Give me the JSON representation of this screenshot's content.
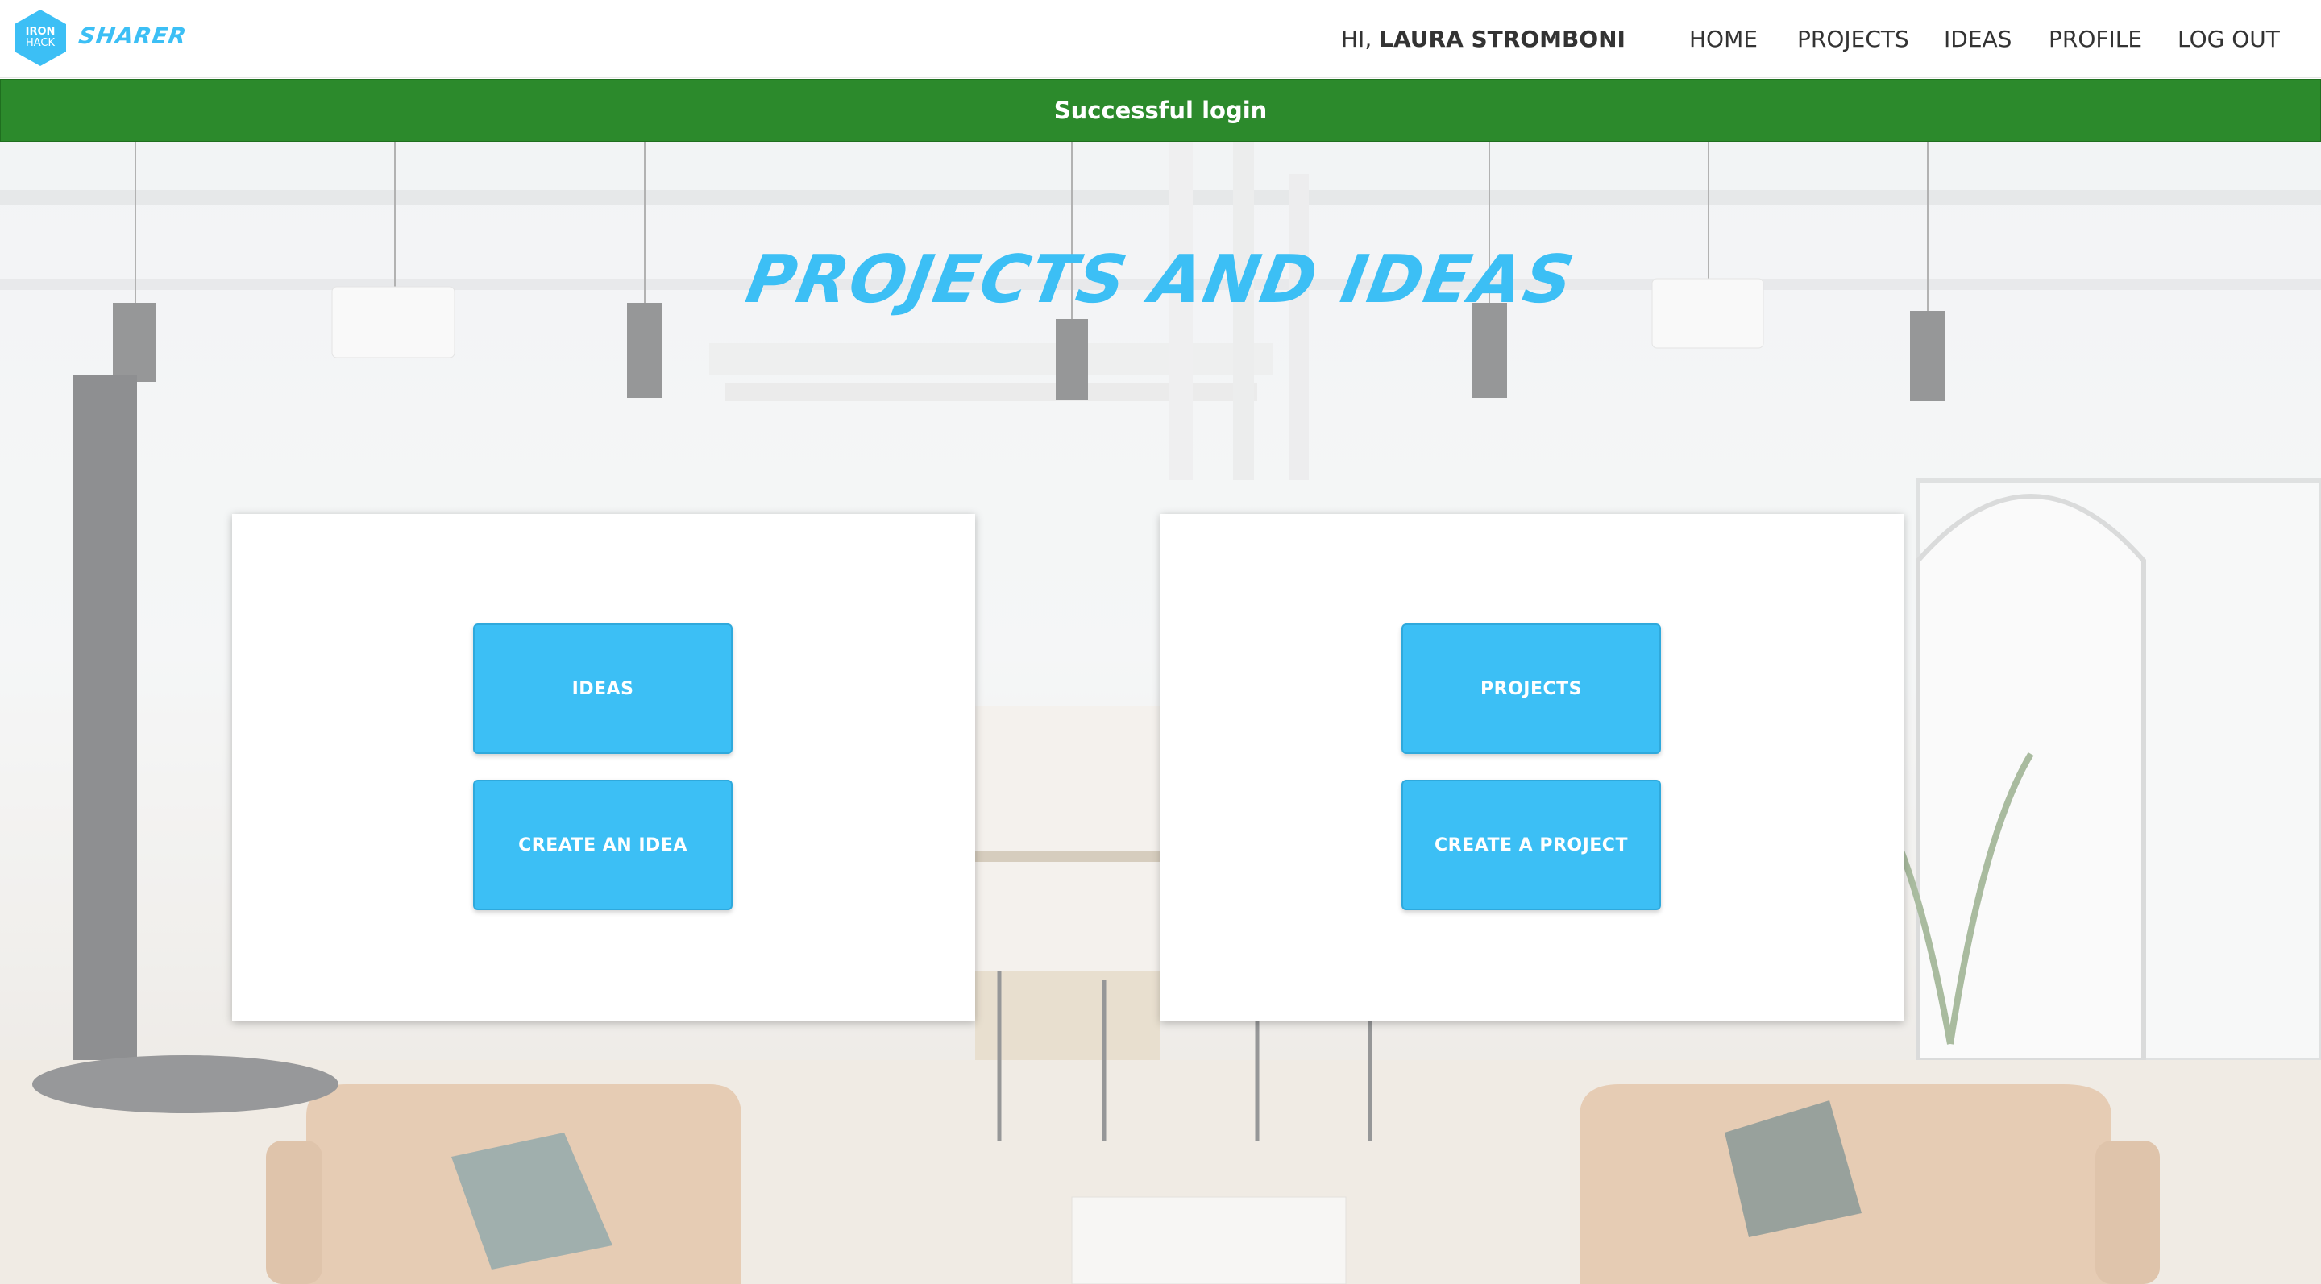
{
  "header": {
    "logo": {
      "line1": "IRON",
      "line2": "HACK"
    },
    "brand": "Sharer",
    "greeting_prefix": "HI,",
    "user_name": "LAURA STROMBONI",
    "nav": [
      {
        "label": "HOME"
      },
      {
        "label": "PROJECTS"
      },
      {
        "label": "IDEAS"
      },
      {
        "label": "PROFILE"
      },
      {
        "label": "LOG OUT"
      }
    ]
  },
  "flash": {
    "message": "Successful login",
    "color": "#2c8a2c"
  },
  "main": {
    "title": "PROJECTS AND IDEAS",
    "cards": [
      {
        "buttons": [
          {
            "label": "IDEAS"
          },
          {
            "label": "CREATE AN IDEA"
          }
        ]
      },
      {
        "buttons": [
          {
            "label": "PROJECTS"
          },
          {
            "label": "CREATE A PROJECT"
          }
        ]
      }
    ]
  },
  "colors": {
    "accent": "#3cbff5",
    "flash": "#2c8a2c",
    "text": "#333333"
  }
}
